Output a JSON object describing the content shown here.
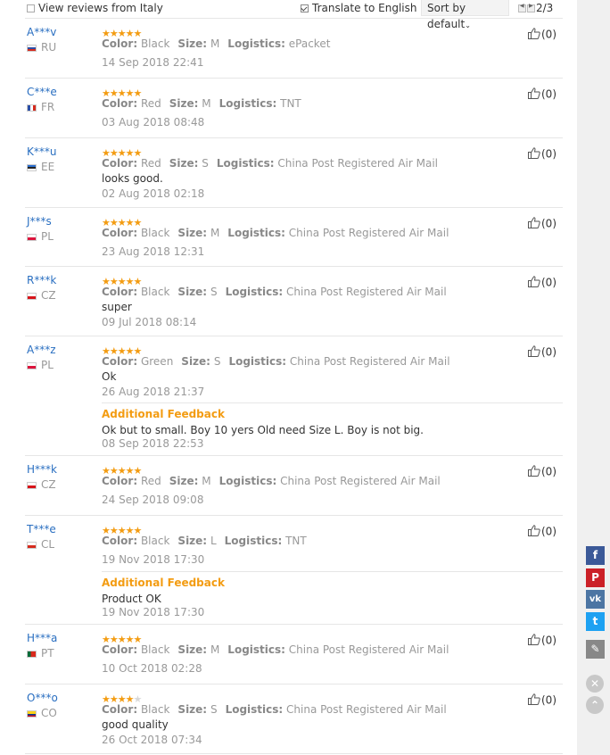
{
  "toolbar": {
    "view_reviews_label": "View reviews from Italy",
    "view_reviews_checked": false,
    "translate_label": "Translate to English",
    "translate_checked": true,
    "sort_label": "Sort by default",
    "page_indicator": "2/3"
  },
  "labels": {
    "color": "Color:",
    "size": "Size:",
    "logistics": "Logistics:",
    "additional_feedback": "Additional Feedback"
  },
  "reviews": [
    {
      "user": "A***v",
      "country": "RU",
      "flag": "ru",
      "stars": 5,
      "color": "Black",
      "size": "M",
      "logistics": "ePacket",
      "comment": "",
      "date": "14 Sep 2018 22:41",
      "helpful": "(0)"
    },
    {
      "user": "C***e",
      "country": "FR",
      "flag": "fr",
      "stars": 5,
      "color": "Red",
      "size": "M",
      "logistics": "TNT",
      "comment": "",
      "date": "03 Aug 2018 08:48",
      "helpful": "(0)"
    },
    {
      "user": "K***u",
      "country": "EE",
      "flag": "ee",
      "stars": 5,
      "color": "Red",
      "size": "S",
      "logistics": "China Post Registered Air Mail",
      "comment": "looks good.",
      "date": "02 Aug 2018 02:18",
      "helpful": "(0)"
    },
    {
      "user": "J***s",
      "country": "PL",
      "flag": "pl",
      "stars": 5,
      "color": "Black",
      "size": "M",
      "logistics": "China Post Registered Air Mail",
      "comment": "",
      "date": "23 Aug 2018 12:31",
      "helpful": "(0)"
    },
    {
      "user": "R***k",
      "country": "CZ",
      "flag": "cz",
      "stars": 5,
      "color": "Black",
      "size": "S",
      "logistics": "China Post Registered Air Mail",
      "comment": "super",
      "date": "09 Jul 2018 08:14",
      "helpful": "(0)"
    },
    {
      "user": "A***z",
      "country": "PL",
      "flag": "pl",
      "stars": 5,
      "color": "Green",
      "size": "S",
      "logistics": "China Post Registered Air Mail",
      "comment": "Ok",
      "date": "26 Aug 2018 21:37",
      "helpful": "(0)",
      "feedback": {
        "text": "Ok but to small. Boy 10 yers Old need Size L. Boy is not big.",
        "date": "08 Sep 2018 22:53"
      }
    },
    {
      "user": "H***k",
      "country": "CZ",
      "flag": "cz",
      "stars": 5,
      "color": "Red",
      "size": "M",
      "logistics": "China Post Registered Air Mail",
      "comment": "",
      "date": "24 Sep 2018 09:08",
      "helpful": "(0)"
    },
    {
      "user": "T***e",
      "country": "CL",
      "flag": "cl",
      "stars": 5,
      "color": "Black",
      "size": "L",
      "logistics": "TNT",
      "comment": "",
      "date": "19 Nov 2018 17:30",
      "helpful": "(0)",
      "feedback": {
        "text": "Product OK",
        "date": "19 Nov 2018 17:30"
      }
    },
    {
      "user": "H***a",
      "country": "PT",
      "flag": "pt",
      "stars": 5,
      "color": "Black",
      "size": "M",
      "logistics": "China Post Registered Air Mail",
      "comment": "",
      "date": "10 Oct 2018 02:28",
      "helpful": "(0)"
    },
    {
      "user": "O***o",
      "country": "CO",
      "flag": "co",
      "stars": 4,
      "color": "Black",
      "size": "S",
      "logistics": "China Post Registered Air Mail",
      "comment": "good quality",
      "date": "26 Oct 2018 07:34",
      "helpful": "(0)"
    }
  ],
  "share": {
    "facebook": "f",
    "pinterest": "P",
    "vk": "vk",
    "twitter": "t",
    "edit": "✎",
    "close": "✕",
    "top": "⌃"
  }
}
